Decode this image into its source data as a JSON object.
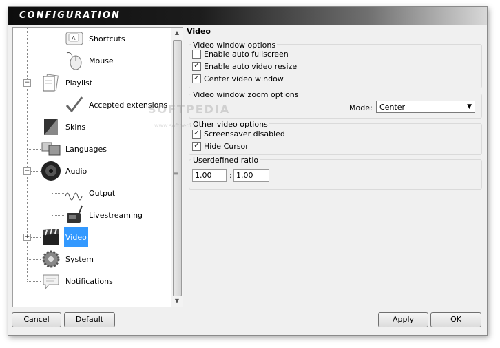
{
  "window": {
    "title": "CONFIGURATION"
  },
  "tree": {
    "items": [
      {
        "label": "Shortcuts",
        "icon": "keyboard-key-icon"
      },
      {
        "label": "Mouse",
        "icon": "mouse-icon"
      },
      {
        "label": "Playlist",
        "icon": "playlist-documents-icon",
        "expander": "−"
      },
      {
        "label": "Accepted extensions",
        "icon": "checkmark-icon"
      },
      {
        "label": "Skins",
        "icon": "skins-icon"
      },
      {
        "label": "Languages",
        "icon": "languages-icon"
      },
      {
        "label": "Audio",
        "icon": "speaker-icon",
        "expander": "−"
      },
      {
        "label": "Output",
        "icon": "waveform-icon",
        "icon_text": "output"
      },
      {
        "label": "Livestreaming",
        "icon": "radio-icon"
      },
      {
        "label": "Video",
        "icon": "clapperboard-icon",
        "expander": "+",
        "selected": true
      },
      {
        "label": "System",
        "icon": "gears-icon"
      },
      {
        "label": "Notifications",
        "icon": "speech-bubble-icon"
      }
    ]
  },
  "panel": {
    "title": "Video",
    "group_window": {
      "title": "Video window options",
      "options": [
        {
          "label": "Enable auto fullscreen",
          "checked": false
        },
        {
          "label": "Enable auto video resize",
          "checked": true
        },
        {
          "label": "Center video window",
          "checked": true
        }
      ]
    },
    "group_zoom": {
      "title": "Video window zoom options",
      "mode_label": "Mode:",
      "mode_value": "Center"
    },
    "group_other": {
      "title": "Other video options",
      "options": [
        {
          "label": "Screensaver disabled",
          "checked": true
        },
        {
          "label": "Hide Cursor",
          "checked": true
        }
      ]
    },
    "group_ratio": {
      "title": "Userdefined ratio",
      "value_a": "1.00",
      "separator": ":",
      "value_b": "1.00"
    }
  },
  "buttons": {
    "cancel": "Cancel",
    "default": "Default",
    "apply": "Apply",
    "ok": "OK"
  },
  "watermark": {
    "text": "SOFTPEDIA",
    "sub": "www.softpedia.com"
  },
  "colors": {
    "selection": "#3399ff",
    "titlebar": "#111111"
  }
}
